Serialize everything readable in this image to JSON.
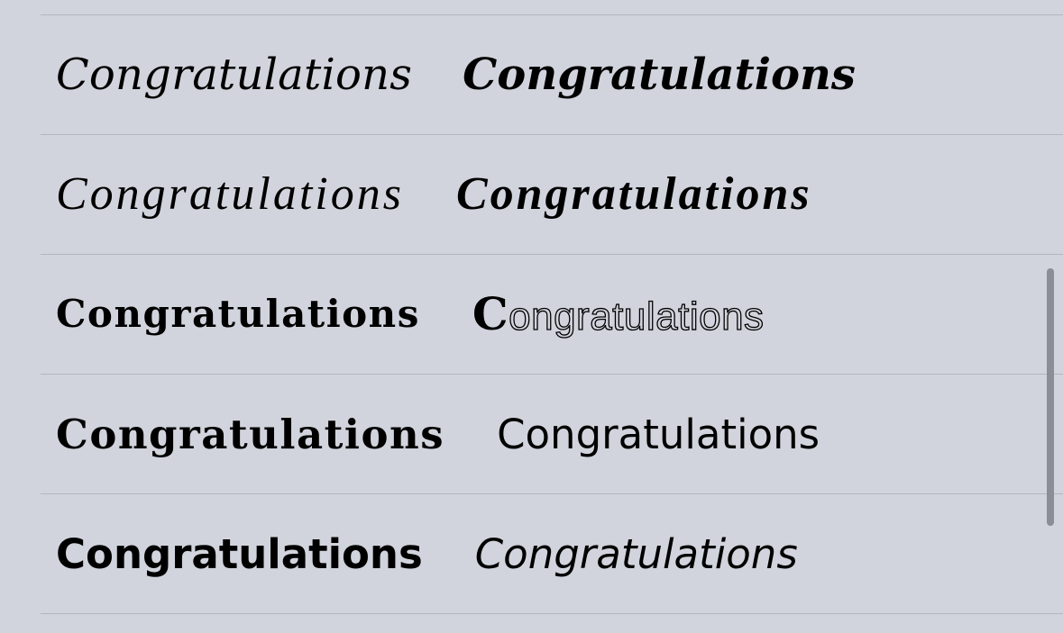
{
  "font_list": {
    "rows": [
      {
        "left": "Congratulations",
        "right": "Congratulations"
      },
      {
        "left": "Congratulations",
        "right": "Congratulations"
      },
      {
        "left": "Congratulations",
        "right_cap": "C",
        "right_rest": "ongratulations"
      },
      {
        "left": "Congratulations",
        "right": "Congratulations"
      },
      {
        "left": "Congratulations",
        "right": "Congratulations"
      }
    ]
  },
  "colors": {
    "background": "#d1d4dc",
    "separator": "#b3b6bd",
    "scrollbar": "#8b8e95",
    "text": "#000000"
  }
}
